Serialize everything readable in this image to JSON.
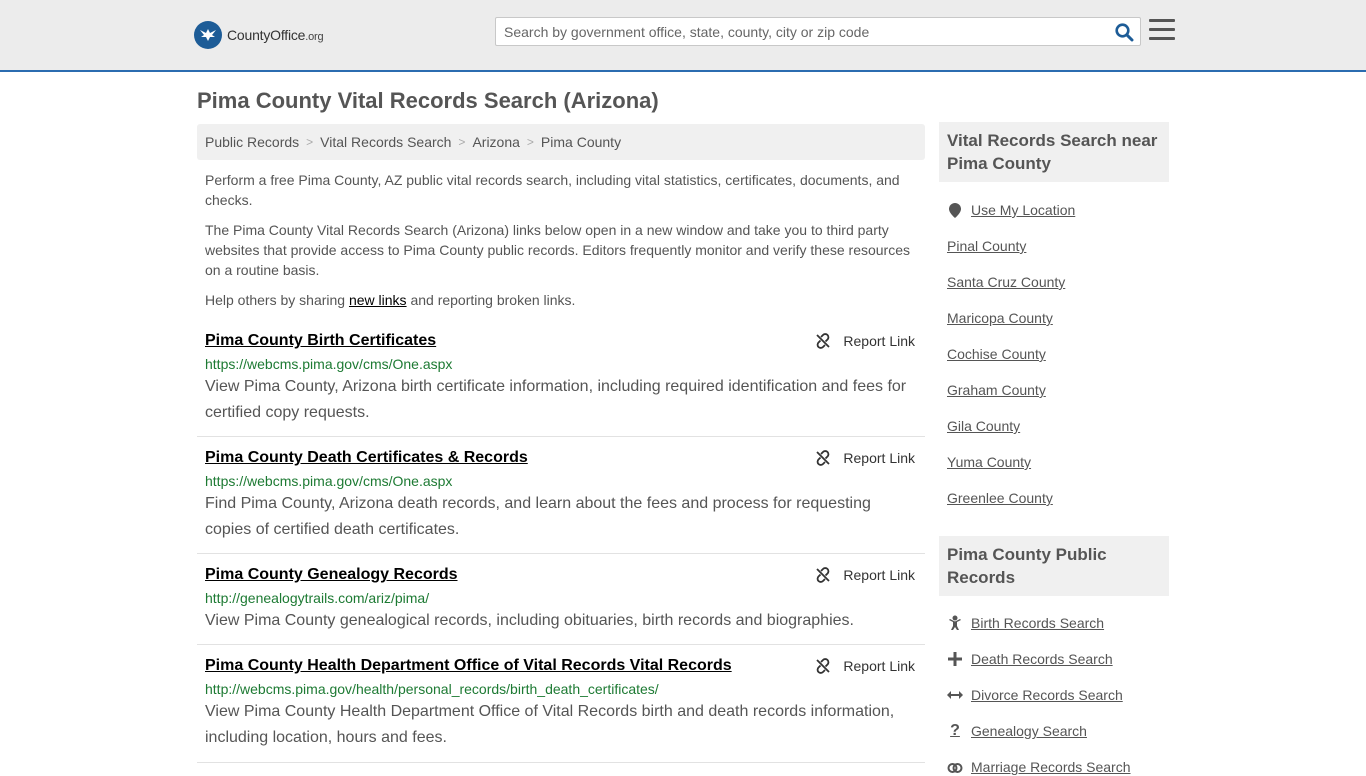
{
  "header": {
    "logo_text": "CountyOffice",
    "logo_suffix": ".org",
    "search_placeholder": "Search by government office, state, county, city or zip code"
  },
  "page": {
    "title": "Pima County Vital Records Search (Arizona)"
  },
  "breadcrumb": [
    "Public Records",
    "Vital Records Search",
    "Arizona",
    "Pima County"
  ],
  "intro": {
    "p1": "Perform a free Pima County, AZ public vital records search, including vital statistics, certificates, documents, and checks.",
    "p2": "The Pima County Vital Records Search (Arizona) links below open in a new window and take you to third party websites that provide access to Pima County public records. Editors frequently monitor and verify these resources on a routine basis.",
    "p3_before": "Help others by sharing ",
    "p3_link": "new links",
    "p3_after": " and reporting broken links."
  },
  "report_label": "Report Link",
  "results": [
    {
      "title": "Pima County Birth Certificates",
      "url": "https://webcms.pima.gov/cms/One.aspx",
      "desc": "View Pima County, Arizona birth certificate information, including required identification and fees for certified copy requests."
    },
    {
      "title": "Pima County Death Certificates & Records",
      "url": "https://webcms.pima.gov/cms/One.aspx",
      "desc": "Find Pima County, Arizona death records, and learn about the fees and process for requesting copies of certified death certificates."
    },
    {
      "title": "Pima County Genealogy Records",
      "url": "http://genealogytrails.com/ariz/pima/",
      "desc": "View Pima County genealogical records, including obituaries, birth records and biographies."
    },
    {
      "title": "Pima County Health Department Office of Vital Records Vital Records",
      "url": "http://webcms.pima.gov/health/personal_records/birth_death_certificates/",
      "desc": "View Pima County Health Department Office of Vital Records birth and death records information, including location, hours and fees."
    }
  ],
  "sidebar": {
    "nearby_heading": "Vital Records Search near Pima County",
    "use_location": "Use My Location",
    "nearby": [
      "Pinal County",
      "Santa Cruz County",
      "Maricopa County",
      "Cochise County",
      "Graham County",
      "Gila County",
      "Yuma County",
      "Greenlee County"
    ],
    "records_heading": "Pima County Public Records",
    "records": [
      {
        "label": "Birth Records Search",
        "icon": "baby-icon"
      },
      {
        "label": "Death Records Search",
        "icon": "cross-icon"
      },
      {
        "label": "Divorce Records Search",
        "icon": "arrows-horizontal-icon"
      },
      {
        "label": "Genealogy Search",
        "icon": "question-icon"
      },
      {
        "label": "Marriage Records Search",
        "icon": "rings-icon"
      }
    ]
  },
  "colors": {
    "accent": "#2b6cb0",
    "url_green": "#1d7a33",
    "panel_gray": "#f0f0f0"
  }
}
